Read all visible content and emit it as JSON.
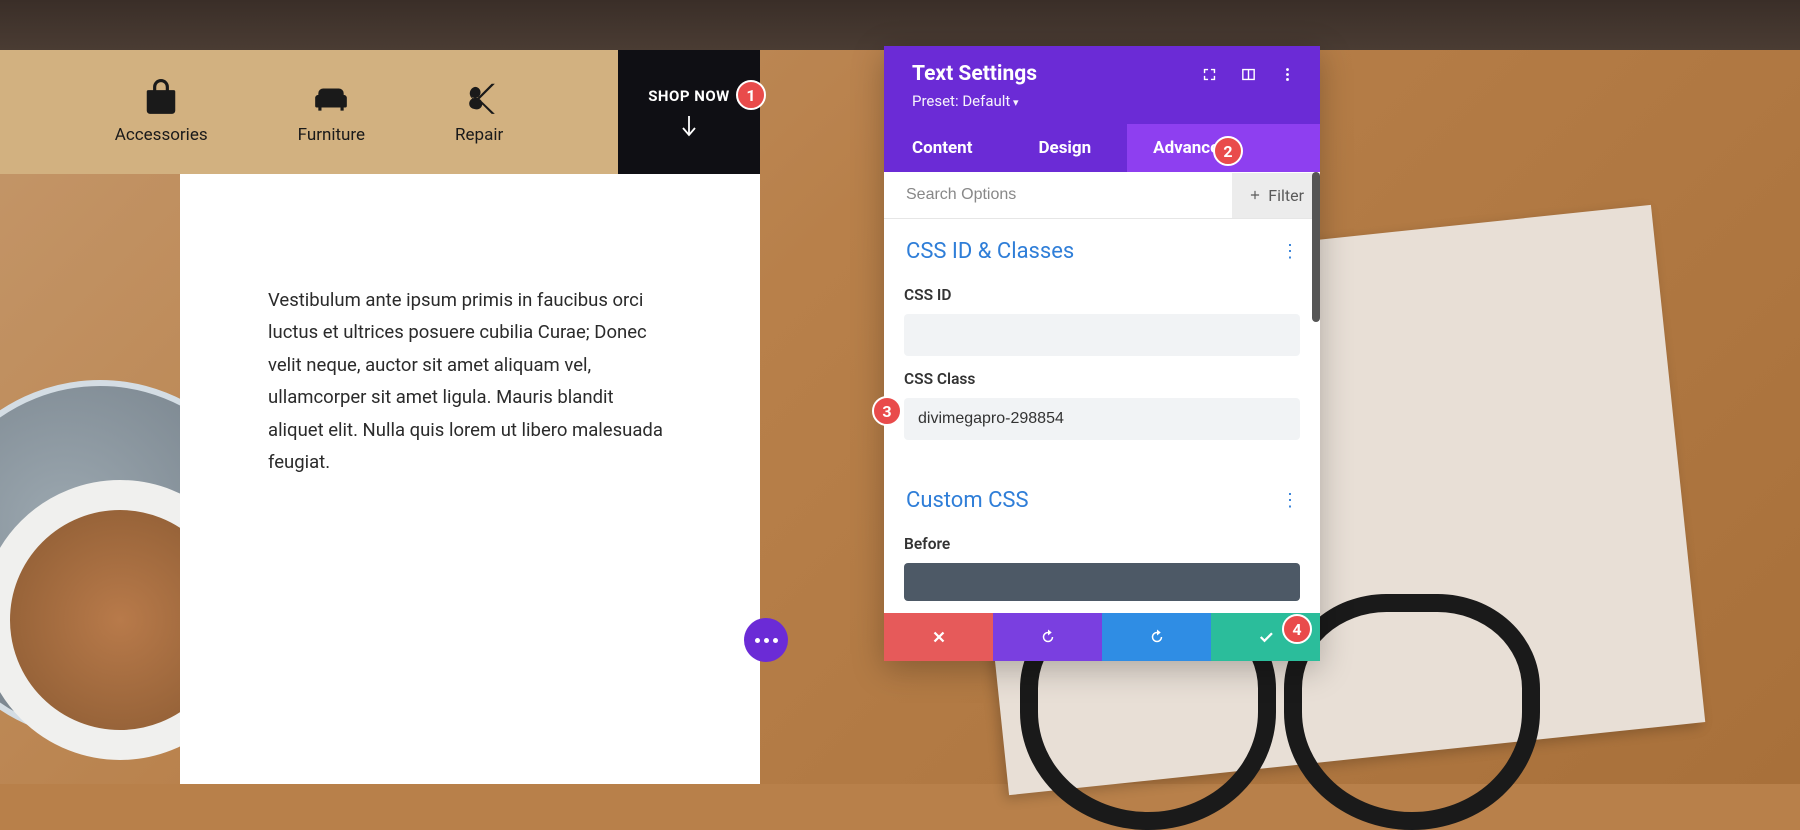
{
  "nav": {
    "items": [
      {
        "label": "Accessories",
        "icon": "bag-icon"
      },
      {
        "label": "Furniture",
        "icon": "sofa-icon"
      },
      {
        "label": "Repair",
        "icon": "scissors-icon"
      }
    ],
    "cta": "SHOP NOW"
  },
  "content": {
    "body": "Vestibulum ante ipsum primis in faucibus orci luctus et ultrices posuere cubilia Curae; Donec velit neque, auctor sit amet aliquam vel, ullamcorper sit amet ligula. Mauris blandit aliquet elit. Nulla quis lorem ut libero malesuada feugiat."
  },
  "panel": {
    "title": "Text Settings",
    "preset": "Preset: Default",
    "tabs": [
      "Content",
      "Design",
      "Advanced"
    ],
    "active_tab": 2,
    "search_placeholder": "Search Options",
    "filter_label": "Filter",
    "sections": {
      "css_id_classes": {
        "title": "CSS ID & Classes",
        "fields": {
          "css_id": {
            "label": "CSS ID",
            "value": ""
          },
          "css_class": {
            "label": "CSS Class",
            "value": "divimegapro-298854"
          }
        }
      },
      "custom_css": {
        "title": "Custom CSS",
        "before_label": "Before"
      }
    }
  },
  "annotations": [
    "1",
    "2",
    "3",
    "4"
  ],
  "colors": {
    "panel_primary": "#6b2bd6",
    "panel_active": "#8e3ff0",
    "link": "#2f7ed8",
    "badge": "#e94b4b",
    "nav_bg": "#d2b180",
    "cta_bg": "#0f0f14"
  }
}
